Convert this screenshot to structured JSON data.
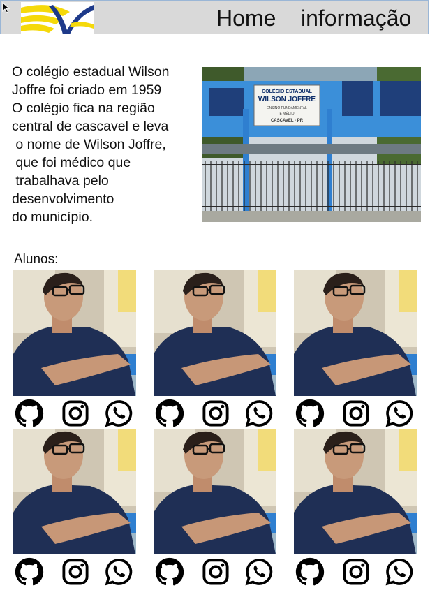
{
  "header": {
    "logo_icon": "school-logo-icon",
    "nav": [
      {
        "label": "Home"
      },
      {
        "label": "informação"
      }
    ]
  },
  "intro": {
    "text": "O colégio estadual Wilson\nJoffre foi criado em 1959\nO colégio fica na região\ncentral de cascavel e leva\n o nome de Wilson Joffre,\n que foi médico que\n trabalhava pelo\ndesenvolvimento\ndo município."
  },
  "school_sign": {
    "line1": "COLÉGIO ESTADUAL",
    "line2": "WILSON JOFFRE",
    "line3": "ENSINO FUNDAMENTAL",
    "line4": "E MÉDIO",
    "line5": "CASCAVEL - PR"
  },
  "students": {
    "heading": "Alunos:",
    "cards": [
      {
        "icons": [
          "github-icon",
          "instagram-icon",
          "whatsapp-icon"
        ]
      },
      {
        "icons": [
          "github-icon",
          "instagram-icon",
          "whatsapp-icon"
        ]
      },
      {
        "icons": [
          "github-icon",
          "instagram-icon",
          "whatsapp-icon"
        ]
      },
      {
        "icons": [
          "github-icon",
          "instagram-icon",
          "whatsapp-icon"
        ]
      },
      {
        "icons": [
          "github-icon",
          "instagram-icon",
          "whatsapp-icon"
        ]
      },
      {
        "icons": [
          "github-icon",
          "instagram-icon",
          "whatsapp-icon"
        ]
      }
    ]
  },
  "colors": {
    "header_bg": "#d9d9d9",
    "logo_blue": "#1e3a8a",
    "logo_yellow": "#f5d90a",
    "school_blue": "#3b8fd9"
  }
}
